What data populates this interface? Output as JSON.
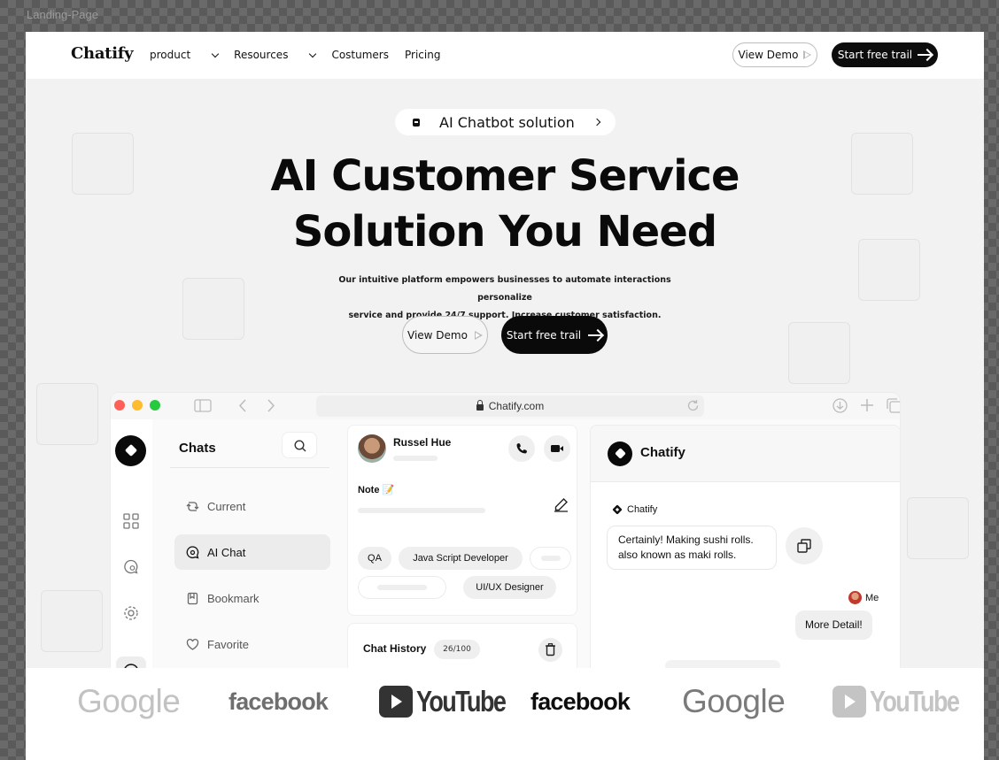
{
  "frame_label": "Landing-Page",
  "nav": {
    "logo": "Chatify",
    "links": [
      "product",
      "Resources",
      "Costumers",
      "Pricing"
    ],
    "view_demo": "View Demo",
    "start_trial": "Start free trail"
  },
  "hero": {
    "pill": "AI Chatbot solution",
    "title_line1": "AI Customer Service",
    "title_line2": "Solution You Need",
    "subtitle_line1": "Our intuitive platform empowers businesses to automate interactions personalize",
    "subtitle_line2": "service and provide 24/7 support. Increase customer satisfaction.",
    "view_demo": "View Demo",
    "start_trial": "Start free trail"
  },
  "browser": {
    "url": "Chatify.com"
  },
  "app": {
    "chats_title": "Chats",
    "chat_items": [
      "Current",
      "AI Chat",
      "Bookmark",
      "Favorite"
    ],
    "active_item": "AI Chat",
    "profile_name": "Russel Hue",
    "note_label": "Note 📝",
    "tags": [
      "QA",
      "Java Script Developer",
      "UI/UX Designer"
    ],
    "history_title": "Chat History",
    "history_count": "26/100",
    "convo_title": "Chatify",
    "bot_sender": "Chatify",
    "bot_message_line1": "Certainly! Making sushi rolls.",
    "bot_message_line2": "also known as maki rolls.",
    "me_label": "Me",
    "me_message": "More Detail!"
  },
  "logos": [
    "Google",
    "facebook",
    "YouTube",
    "facebook",
    "Google",
    "YouTube"
  ]
}
